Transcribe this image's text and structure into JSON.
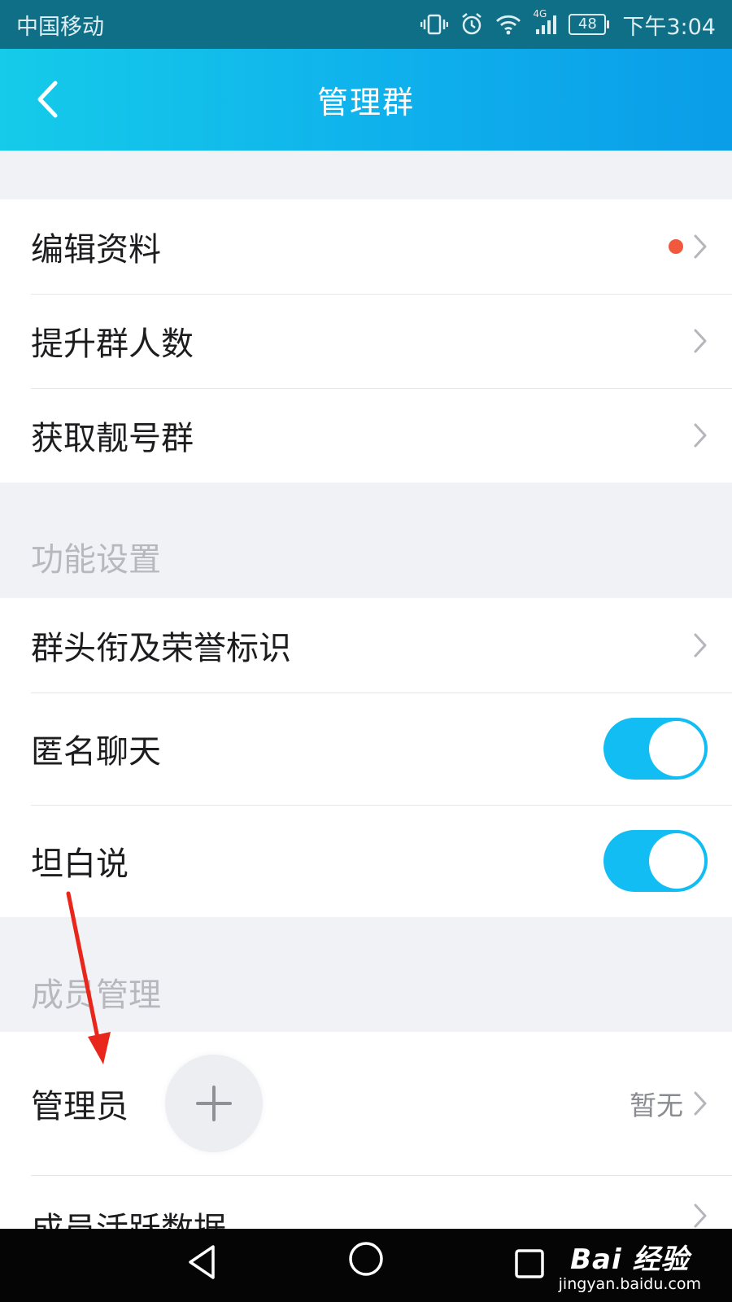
{
  "status_bar": {
    "carrier": "中国移动",
    "network": "4G",
    "battery": "48",
    "time": "下午3:04"
  },
  "header": {
    "title": "管理群"
  },
  "group1": {
    "items": [
      {
        "label": "编辑资料",
        "has_dot": true
      },
      {
        "label": "提升群人数"
      },
      {
        "label": "获取靓号群"
      }
    ]
  },
  "sections": {
    "feature_settings": "功能设置",
    "member_management": "成员管理"
  },
  "group2": {
    "items": [
      {
        "label": "群头衔及荣誉标识"
      },
      {
        "label": "匿名聊天",
        "toggle_on": true
      },
      {
        "label": "坦白说",
        "toggle_on": true
      }
    ]
  },
  "group3": {
    "items": [
      {
        "label": "管理员",
        "value": "暂无"
      },
      {
        "label": "成员活跃数据"
      }
    ]
  },
  "watermark": {
    "brand": "Bai 经验",
    "url": "jingyan.baidu.com"
  },
  "colors": {
    "accent": "#11bdf2",
    "header_start": "#15cbe9",
    "header_end": "#0a9de8",
    "notification_dot": "#f0593e",
    "annotation_arrow": "#e8261c"
  }
}
